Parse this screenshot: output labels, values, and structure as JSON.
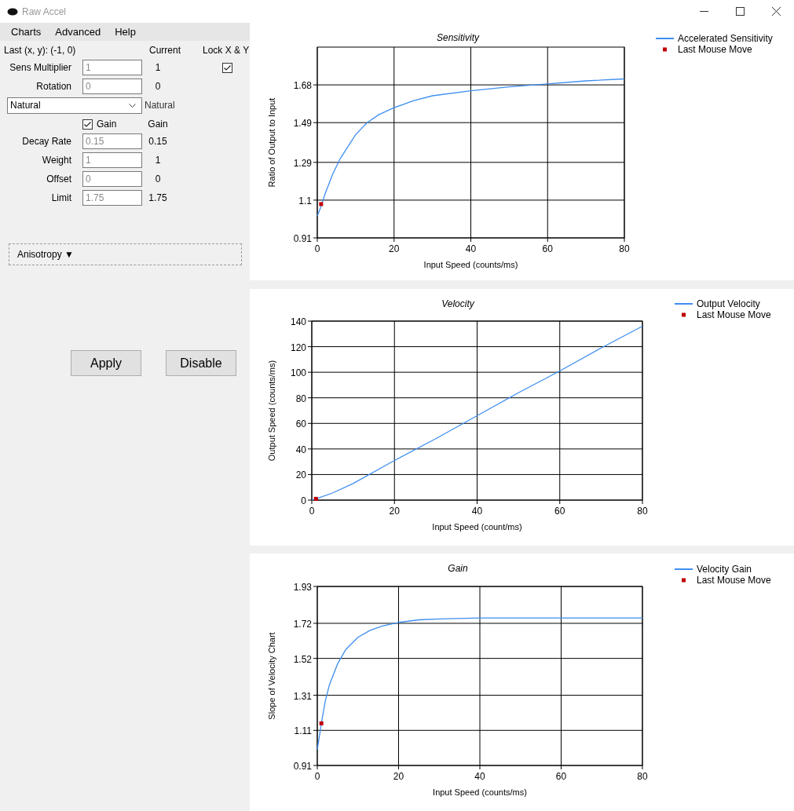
{
  "window": {
    "title": "Raw Accel"
  },
  "menu": [
    {
      "label": "Charts"
    },
    {
      "label": "Advanced"
    },
    {
      "label": "Help"
    }
  ],
  "panel": {
    "last_move": "Last (x, y): (-1, 0)",
    "current_heading": "Current",
    "lock_xy": {
      "label": "Lock X & Y",
      "checked": true
    },
    "fields": [
      {
        "label": "Sens Multiplier",
        "value": "1",
        "current": "1"
      },
      {
        "label": "Rotation",
        "value": "0",
        "current": "0"
      }
    ],
    "mode": {
      "value": "Natural",
      "current": "Natural"
    },
    "gain": {
      "label": "Gain",
      "checked": true,
      "current": "Gain"
    },
    "parameters": [
      {
        "label": "Decay Rate",
        "value": "0.15",
        "current": "0.15"
      },
      {
        "label": "Weight",
        "value": "1",
        "current": "1"
      },
      {
        "label": "Offset",
        "value": "0",
        "current": "0"
      },
      {
        "label": "Limit",
        "value": "1.75",
        "current": "1.75"
      }
    ],
    "anisotropy": "Anisotropy ▼",
    "buttons": [
      {
        "label": "Apply"
      },
      {
        "label": "Disable"
      }
    ]
  },
  "charts": [
    {
      "chart_data": {
        "type": "line",
        "title": "Sensitivity",
        "xlabel": "Input Speed (counts/ms)",
        "ylabel": "Ratio of Output to Input",
        "x": [
          0,
          1,
          2,
          4,
          6,
          8,
          10,
          13,
          16,
          20,
          25,
          30,
          40,
          50,
          60,
          70,
          80
        ],
        "xlim": [
          0,
          80
        ],
        "ylim": [
          0.91,
          1.87
        ],
        "xticks": [
          0,
          20,
          40,
          60,
          80
        ],
        "yticks": [
          0.91,
          1.1,
          1.29,
          1.49,
          1.68
        ],
        "grid": true,
        "legend": true,
        "series": [
          {
            "name": "Accelerated Sensitivity",
            "color": "#3f8ff0",
            "values": [
              1.02,
              1.07,
              1.13,
              1.23,
              1.31,
              1.37,
              1.43,
              1.49,
              1.53,
              1.565,
              1.6,
              1.625,
              1.65,
              1.67,
              1.685,
              1.7,
              1.71
            ]
          },
          {
            "name": "Last Mouse Move",
            "marker": "square",
            "color": "#c00000",
            "values": [
              null,
              1.08,
              null,
              null,
              null,
              null,
              null,
              null,
              null,
              null,
              null,
              null,
              null,
              null,
              null,
              null,
              null
            ]
          }
        ]
      }
    },
    {
      "chart_data": {
        "type": "line",
        "title": "Velocity",
        "xlabel": "Input Speed (count/ms)",
        "ylabel": "Output Speed (counts/ms)",
        "x": [
          0,
          1,
          5,
          10,
          20,
          30,
          40,
          50,
          60,
          70,
          80
        ],
        "xlim": [
          0,
          80
        ],
        "ylim": [
          0,
          140
        ],
        "xticks": [
          0,
          20,
          40,
          60,
          80
        ],
        "yticks": [
          0,
          20,
          40,
          60,
          80,
          100,
          120,
          140
        ],
        "grid": true,
        "legend": true,
        "series": [
          {
            "name": "Output Velocity",
            "color": "#3f8ff0",
            "values": [
              0,
              1,
              5.5,
              13,
              31,
              48,
              66,
              84,
              101,
              119,
              136
            ]
          },
          {
            "name": "Last Mouse Move",
            "marker": "square",
            "color": "#c00000",
            "values": [
              null,
              1,
              null,
              null,
              null,
              null,
              null,
              null,
              null,
              null,
              null
            ]
          }
        ]
      }
    },
    {
      "chart_data": {
        "type": "line",
        "title": "Gain",
        "xlabel": "Input Speed (counts/ms)",
        "ylabel": "Slope of Velocity Chart",
        "x": [
          0,
          1,
          2,
          3,
          5,
          7,
          10,
          13,
          16,
          20,
          25,
          30,
          40,
          60,
          80
        ],
        "xlim": [
          0,
          80
        ],
        "ylim": [
          0.91,
          1.93
        ],
        "xticks": [
          0,
          20,
          40,
          60,
          80
        ],
        "yticks": [
          0.91,
          1.11,
          1.31,
          1.52,
          1.72,
          1.93
        ],
        "grid": true,
        "legend": true,
        "series": [
          {
            "name": "Velocity Gain",
            "color": "#3f8ff0",
            "values": [
              1.0,
              1.15,
              1.28,
              1.37,
              1.49,
              1.57,
              1.64,
              1.68,
              1.705,
              1.725,
              1.74,
              1.745,
              1.75,
              1.75,
              1.75
            ]
          },
          {
            "name": "Last Mouse Move",
            "marker": "square",
            "color": "#c00000",
            "values": [
              null,
              1.15,
              null,
              null,
              null,
              null,
              null,
              null,
              null,
              null,
              null,
              null,
              null,
              null,
              null
            ]
          }
        ]
      }
    }
  ]
}
